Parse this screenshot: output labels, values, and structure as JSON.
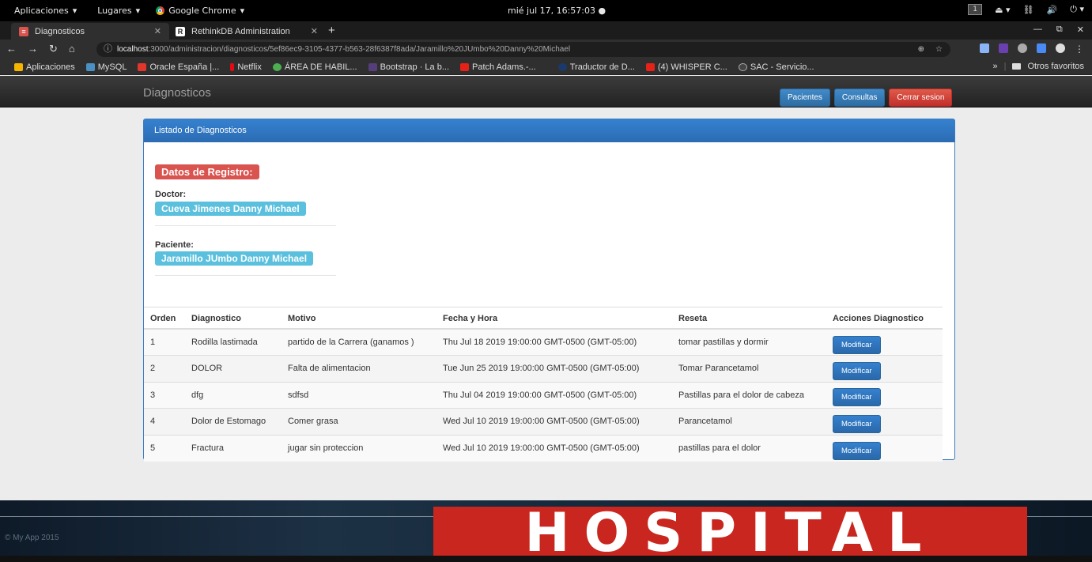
{
  "system_bar": {
    "menu1": "Aplicaciones",
    "menu2": "Lugares",
    "app": "Google Chrome",
    "clock": "mié jul 17, 16:57:03",
    "workspace": "1"
  },
  "browser": {
    "tabs": [
      {
        "label": "Diagnosticos",
        "icon": "app-icon",
        "color": "#d9534f"
      },
      {
        "label": "RethinkDB Administration",
        "icon": "rethinkdb-icon",
        "color": "#ffffff"
      }
    ],
    "url_host": "localhost",
    "url_path": ":3000/administracion/diagnosticos/5ef86ec9-3105-4377-b563-28f6387f8ada/Jaramillo%20JUmbo%20Danny%20Michael",
    "bookmarks": [
      {
        "label": "Aplicaciones",
        "color": "#f4b400"
      },
      {
        "label": "MySQL",
        "color": "#4a90c2"
      },
      {
        "label": "Oracle España |...",
        "color": "#e0362b"
      },
      {
        "label": "Netflix",
        "color": "#e50914"
      },
      {
        "label": "ÁREA DE HABIL...",
        "color": "#4caf50"
      },
      {
        "label": "Bootstrap · La b...",
        "color": "#563d7c"
      },
      {
        "label": "Patch Adams.-...",
        "color": "#e62117"
      },
      {
        "label": "Traductor de D...",
        "color": "#1a3a6c"
      },
      {
        "label": "(4) WHISPER C...",
        "color": "#e62117"
      },
      {
        "label": "SAC - Servicio...",
        "color": "#444444"
      }
    ],
    "more": "»",
    "other_bookmarks": "Otros favoritos"
  },
  "navbar": {
    "brand": "Diagnosticos",
    "buttons": [
      "Pacientes",
      "Consultas",
      "Cerrar sesion"
    ]
  },
  "panel": {
    "heading": "Listado de Diagnosticos",
    "registro_label": "Datos de Registro:",
    "doctor_title": "Doctor:",
    "doctor_name": "Cueva Jimenes Danny Michael",
    "paciente_title": "Paciente:",
    "paciente_name": "Jaramillo JUmbo Danny Michael"
  },
  "table": {
    "headers": [
      "Orden",
      "Diagnostico",
      "Motivo",
      "Fecha y Hora",
      "Reseta",
      "Acciones Diagnostico"
    ],
    "action_label": "Modificar",
    "rows": [
      [
        "1",
        "Rodilla lastimada",
        "partido de la Carrera (ganamos )",
        "Thu Jul 18 2019 19:00:00 GMT-0500 (GMT-05:00)",
        "tomar pastillas y dormir"
      ],
      [
        "2",
        "DOLOR",
        "Falta de alimentacion",
        "Tue Jun 25 2019 19:00:00 GMT-0500 (GMT-05:00)",
        "Tomar Parancetamol"
      ],
      [
        "3",
        "dfg",
        "sdfsd",
        "Thu Jul 04 2019 19:00:00 GMT-0500 (GMT-05:00)",
        "Pastillas para el dolor de cabeza"
      ],
      [
        "4",
        "Dolor de Estomago",
        "Comer grasa",
        "Wed Jul 10 2019 19:00:00 GMT-0500 (GMT-05:00)",
        "Parancetamol"
      ],
      [
        "5",
        "Fractura",
        "jugar sin proteccion",
        "Wed Jul 10 2019 19:00:00 GMT-0500 (GMT-05:00)",
        "pastillas para el dolor"
      ]
    ]
  },
  "footer": {
    "copyright": "© My App 2015",
    "banner": "HOSPITAL"
  }
}
